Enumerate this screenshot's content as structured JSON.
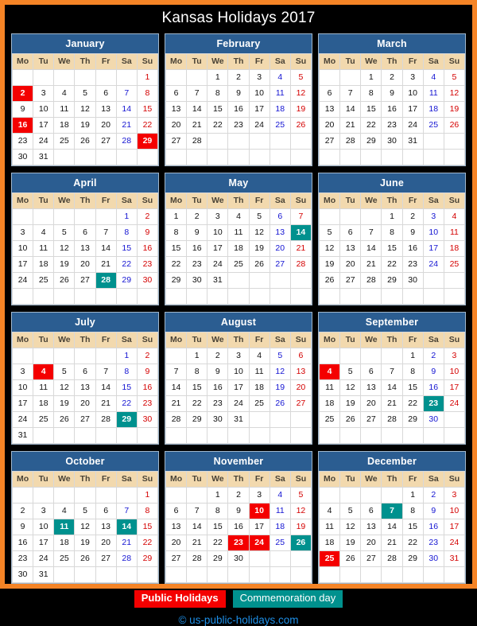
{
  "page": {
    "title": "Kansas Holidays 2017",
    "credit": "© us-public-holidays.com",
    "border_color": "#F58426",
    "background_color": "#000000"
  },
  "colors": {
    "month_header_blue": "#2B5D91",
    "weekday_header_tan": "#F2D9AE",
    "public_holiday_red": "#F40000",
    "commemoration_teal": "#00918E",
    "saturday_blue": "#1414D2",
    "sunday_red": "#D40000",
    "credit_blue": "#1E90E8"
  },
  "weekdays": [
    "Mo",
    "Tu",
    "We",
    "Th",
    "Fr",
    "Sa",
    "Su"
  ],
  "legend": {
    "public_holidays_label": "Public Holidays",
    "commemoration_label": "Commemoration day"
  },
  "months": [
    {
      "name": "January",
      "weeks": [
        [
          null,
          null,
          null,
          null,
          null,
          null,
          1
        ],
        [
          2,
          3,
          4,
          5,
          6,
          7,
          8
        ],
        [
          9,
          10,
          11,
          12,
          13,
          14,
          15
        ],
        [
          16,
          17,
          18,
          19,
          20,
          21,
          22
        ],
        [
          23,
          24,
          25,
          26,
          27,
          28,
          29
        ],
        [
          30,
          31,
          null,
          null,
          null,
          null,
          null
        ]
      ],
      "public_holidays": [
        2,
        16,
        29
      ],
      "commemoration_days": []
    },
    {
      "name": "February",
      "weeks": [
        [
          null,
          null,
          1,
          2,
          3,
          4,
          5
        ],
        [
          6,
          7,
          8,
          9,
          10,
          11,
          12
        ],
        [
          13,
          14,
          15,
          16,
          17,
          18,
          19
        ],
        [
          20,
          21,
          22,
          23,
          24,
          25,
          26
        ],
        [
          27,
          28,
          null,
          null,
          null,
          null,
          null
        ],
        [
          null,
          null,
          null,
          null,
          null,
          null,
          null
        ]
      ],
      "public_holidays": [],
      "commemoration_days": []
    },
    {
      "name": "March",
      "weeks": [
        [
          null,
          null,
          1,
          2,
          3,
          4,
          5
        ],
        [
          6,
          7,
          8,
          9,
          10,
          11,
          12
        ],
        [
          13,
          14,
          15,
          16,
          17,
          18,
          19
        ],
        [
          20,
          21,
          22,
          23,
          24,
          25,
          26
        ],
        [
          27,
          28,
          29,
          30,
          31,
          null,
          null
        ],
        [
          null,
          null,
          null,
          null,
          null,
          null,
          null
        ]
      ],
      "public_holidays": [],
      "commemoration_days": []
    },
    {
      "name": "April",
      "weeks": [
        [
          null,
          null,
          null,
          null,
          null,
          1,
          2
        ],
        [
          3,
          4,
          5,
          6,
          7,
          8,
          9
        ],
        [
          10,
          11,
          12,
          13,
          14,
          15,
          16
        ],
        [
          17,
          18,
          19,
          20,
          21,
          22,
          23
        ],
        [
          24,
          25,
          26,
          27,
          28,
          29,
          30
        ],
        [
          null,
          null,
          null,
          null,
          null,
          null,
          null
        ]
      ],
      "public_holidays": [],
      "commemoration_days": [
        28
      ]
    },
    {
      "name": "May",
      "weeks": [
        [
          1,
          2,
          3,
          4,
          5,
          6,
          7
        ],
        [
          8,
          9,
          10,
          11,
          12,
          13,
          14
        ],
        [
          15,
          16,
          17,
          18,
          19,
          20,
          21
        ],
        [
          22,
          23,
          24,
          25,
          26,
          27,
          28
        ],
        [
          29,
          30,
          31,
          null,
          null,
          null,
          null
        ],
        [
          null,
          null,
          null,
          null,
          null,
          null,
          null
        ]
      ],
      "public_holidays": [],
      "commemoration_days": [
        14
      ]
    },
    {
      "name": "June",
      "weeks": [
        [
          null,
          null,
          null,
          1,
          2,
          3,
          4
        ],
        [
          5,
          6,
          7,
          8,
          9,
          10,
          11
        ],
        [
          12,
          13,
          14,
          15,
          16,
          17,
          18
        ],
        [
          19,
          20,
          21,
          22,
          23,
          24,
          25
        ],
        [
          26,
          27,
          28,
          29,
          30,
          null,
          null
        ],
        [
          null,
          null,
          null,
          null,
          null,
          null,
          null
        ]
      ],
      "public_holidays": [],
      "commemoration_days": []
    },
    {
      "name": "July",
      "weeks": [
        [
          null,
          null,
          null,
          null,
          null,
          1,
          2
        ],
        [
          3,
          4,
          5,
          6,
          7,
          8,
          9
        ],
        [
          10,
          11,
          12,
          13,
          14,
          15,
          16
        ],
        [
          17,
          18,
          19,
          20,
          21,
          22,
          23
        ],
        [
          24,
          25,
          26,
          27,
          28,
          29,
          30
        ],
        [
          31,
          null,
          null,
          null,
          null,
          null,
          null
        ]
      ],
      "public_holidays": [
        4
      ],
      "commemoration_days": [
        29
      ]
    },
    {
      "name": "August",
      "weeks": [
        [
          null,
          1,
          2,
          3,
          4,
          5,
          6
        ],
        [
          7,
          8,
          9,
          10,
          11,
          12,
          13
        ],
        [
          14,
          15,
          16,
          17,
          18,
          19,
          20
        ],
        [
          21,
          22,
          23,
          24,
          25,
          26,
          27
        ],
        [
          28,
          29,
          30,
          31,
          null,
          null,
          null
        ],
        [
          null,
          null,
          null,
          null,
          null,
          null,
          null
        ]
      ],
      "public_holidays": [],
      "commemoration_days": []
    },
    {
      "name": "September",
      "weeks": [
        [
          null,
          null,
          null,
          null,
          1,
          2,
          3
        ],
        [
          4,
          5,
          6,
          7,
          8,
          9,
          10
        ],
        [
          11,
          12,
          13,
          14,
          15,
          16,
          17
        ],
        [
          18,
          19,
          20,
          21,
          22,
          23,
          24
        ],
        [
          25,
          26,
          27,
          28,
          29,
          30,
          null
        ],
        [
          null,
          null,
          null,
          null,
          null,
          null,
          null
        ]
      ],
      "public_holidays": [
        4
      ],
      "commemoration_days": [
        23
      ]
    },
    {
      "name": "October",
      "weeks": [
        [
          null,
          null,
          null,
          null,
          null,
          null,
          1
        ],
        [
          2,
          3,
          4,
          5,
          6,
          7,
          8
        ],
        [
          9,
          10,
          11,
          12,
          13,
          14,
          15
        ],
        [
          16,
          17,
          18,
          19,
          20,
          21,
          22
        ],
        [
          23,
          24,
          25,
          26,
          27,
          28,
          29
        ],
        [
          30,
          31,
          null,
          null,
          null,
          null,
          null
        ]
      ],
      "public_holidays": [],
      "commemoration_days": [
        11,
        14
      ]
    },
    {
      "name": "November",
      "weeks": [
        [
          null,
          null,
          1,
          2,
          3,
          4,
          5
        ],
        [
          6,
          7,
          8,
          9,
          10,
          11,
          12
        ],
        [
          13,
          14,
          15,
          16,
          17,
          18,
          19
        ],
        [
          20,
          21,
          22,
          23,
          24,
          25,
          26
        ],
        [
          27,
          28,
          29,
          30,
          null,
          null,
          null
        ],
        [
          null,
          null,
          null,
          null,
          null,
          null,
          null
        ]
      ],
      "public_holidays": [
        10,
        23,
        24
      ],
      "commemoration_days": [
        26
      ]
    },
    {
      "name": "December",
      "weeks": [
        [
          null,
          null,
          null,
          null,
          1,
          2,
          3
        ],
        [
          4,
          5,
          6,
          7,
          8,
          9,
          10
        ],
        [
          11,
          12,
          13,
          14,
          15,
          16,
          17
        ],
        [
          18,
          19,
          20,
          21,
          22,
          23,
          24
        ],
        [
          25,
          26,
          27,
          28,
          29,
          30,
          31
        ],
        [
          null,
          null,
          null,
          null,
          null,
          null,
          null
        ]
      ],
      "public_holidays": [
        25
      ],
      "commemoration_days": [
        7
      ]
    }
  ]
}
